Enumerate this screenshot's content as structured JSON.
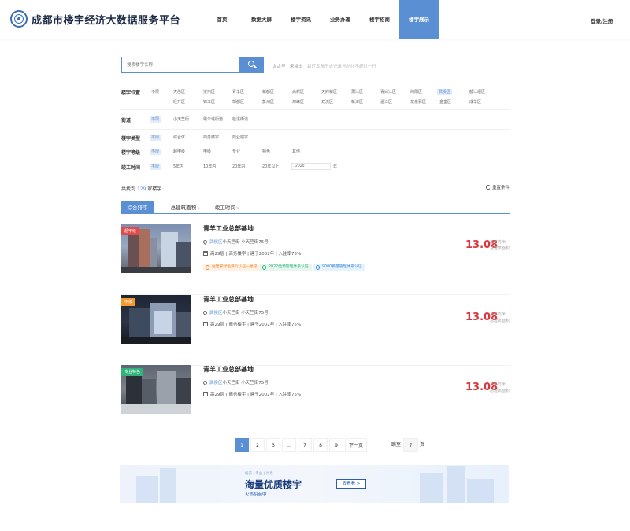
{
  "header": {
    "site_title": "成都市楼宇经济大数据服务平台",
    "nav": [
      "首页",
      "数据大屏",
      "楼宇资讯",
      "业务办理",
      "楼宇招商",
      "楼宇展示"
    ],
    "active_nav_index": 5,
    "login": "登录/注册"
  },
  "search": {
    "placeholder": "搜索楼宇名称",
    "hot_words": [
      "太古里",
      "来福士"
    ],
    "hint": "最近五条历史记录且总共不超过一行"
  },
  "filters": {
    "location": {
      "label": "楼宇位置",
      "row1": [
        "不限",
        "大邑区",
        "崇州区",
        "青羊区",
        "新都区",
        "高新区",
        "天府新区",
        "蒲江区",
        "青白江区",
        "简阳区",
        "武侯区",
        "都江堰区"
      ],
      "row2": [
        "锦江区",
        "彭州区",
        "郫都区",
        "龙泉驿区",
        "邛崃区",
        "双流区",
        "新津区",
        "温江区",
        "金堂区",
        "成华区"
      ],
      "row2_prefix": "经开区",
      "selected": "武侯区"
    },
    "street": {
      "label": "街道",
      "options": [
        "不限",
        "小天竺街",
        "跳伞塔街道",
        "桂溪街道"
      ],
      "selected": "不限"
    },
    "type": {
      "label": "楼宇类型",
      "options": [
        "不限",
        "综合体",
        "商务楼宇",
        "商业楼宇"
      ],
      "selected": "不限"
    },
    "grade": {
      "label": "楼宇等级",
      "options": [
        "不限",
        "超甲级",
        "甲级",
        "专业",
        "特色",
        "其他"
      ],
      "selected": "不限"
    },
    "completion": {
      "label": "竣工时间",
      "options": [
        "不限",
        "5年内",
        "10年内",
        "20年内",
        "20年以上"
      ],
      "selected": "不限",
      "year_from": "2020",
      "dash": "-",
      "unit": "年"
    }
  },
  "results": {
    "prefix": "共找到",
    "count": "129",
    "suffix": "家楼宇",
    "reset": "重置条件",
    "sort_tabs": [
      "综合排序",
      "总建筑面积",
      "竣工时间"
    ],
    "active_tab": 0
  },
  "listings": [
    {
      "badge": "超甲级",
      "badge_color": "#e24b4b",
      "name": "青羊工业总部基地",
      "district": "武侯区",
      "address": "小天竺街 小天竺街75号",
      "details": "高29层 | 商务楼宇 | 建于2002年 | 入驻率75%",
      "tags": [
        "住建部绿色评价认证一星级",
        "2022能源管理体系认证",
        "9000质量管理体系认证"
      ],
      "price": "13.08",
      "unit_line1": "万平方米",
      "unit_line2": "总建筑面积"
    },
    {
      "badge": "甲级",
      "badge_color": "#f39a2e",
      "name": "青羊工业总部基地",
      "district": "武侯区",
      "address": "小天竺街 小天竺街75号",
      "details": "高29层 | 商务楼宇 | 建于2002年 | 入驻率75%",
      "tags": [],
      "price": "13.08",
      "unit_line1": "万平方米",
      "unit_line2": "总建筑面积"
    },
    {
      "badge": "专业特色",
      "badge_color": "#2fb37a",
      "name": "青羊工业总部基地",
      "district": "武侯区",
      "address": "小天竺街 小天竺街75号",
      "details": "高29层 | 商务楼宇 | 建于2002年 | 入驻率75%",
      "tags": [],
      "price": "13.08",
      "unit_line1": "万平方米",
      "unit_line2": "总建筑面积"
    }
  ],
  "pagination": {
    "pages": [
      "1",
      "2",
      "3",
      "...",
      "7",
      "8",
      "9"
    ],
    "active": "1",
    "next": "下一页",
    "jump_label": "跳至",
    "jump_value": "7",
    "page_unit": "页"
  },
  "banner": {
    "tags": "经前  |  专业  |  灵意",
    "title": "海量优质楼宇",
    "subtitle": "火热招商中",
    "button": "去看看 >"
  },
  "colors": {
    "primary": "#5b8fd4",
    "price": "#d9363e"
  }
}
